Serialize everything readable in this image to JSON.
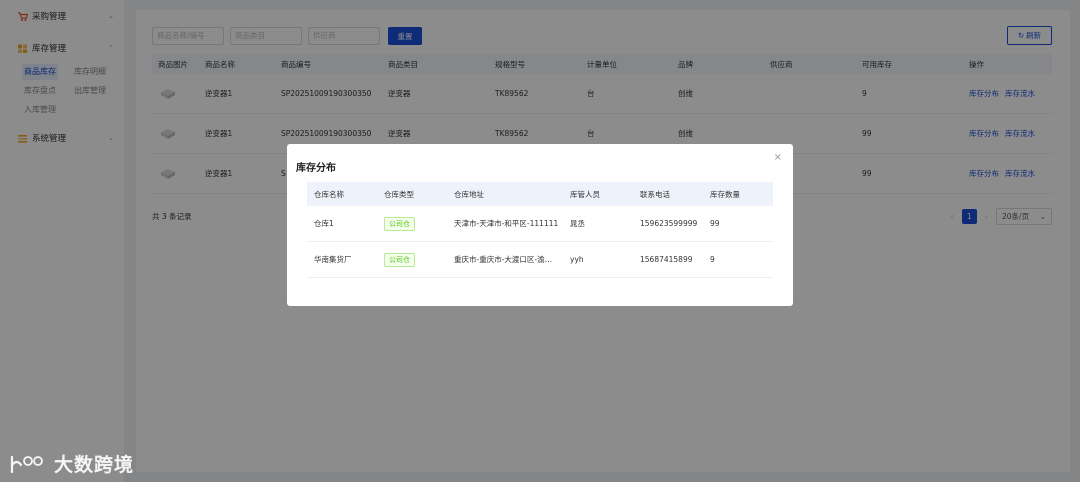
{
  "sidebar": {
    "groups": [
      {
        "label": "采购管理",
        "icon": "cart-icon"
      },
      {
        "label": "库存管理",
        "icon": "inventory-icon"
      },
      {
        "label": "系统管理",
        "icon": "settings-icon"
      }
    ],
    "inventory_items": [
      "商品库存",
      "库存明细",
      "库存盘点",
      "出库管理",
      "入库管理"
    ]
  },
  "filters": {
    "product_placeholder": "商品名称/编号",
    "category_placeholder": "商品类目",
    "supplier_placeholder": "供应商",
    "reset_label": "重置",
    "refresh_label": "刷新"
  },
  "table": {
    "headers": [
      "商品图片",
      "商品名称",
      "商品编号",
      "商品类目",
      "规格型号",
      "计量单位",
      "品牌",
      "供应商",
      "可用库存",
      "操作"
    ],
    "rows": [
      {
        "name": "逆变器1",
        "code": "SP20251009190300350",
        "category": "逆变器",
        "spec": "TK89562",
        "unit": "台",
        "brand": "创维",
        "supplier": "",
        "stock": "9"
      },
      {
        "name": "逆变器1",
        "code": "SP20251009190300350",
        "category": "逆变器",
        "spec": "TK89562",
        "unit": "台",
        "brand": "创维",
        "supplier": "",
        "stock": "99"
      },
      {
        "name": "逆变器1",
        "code": "S",
        "category": "",
        "spec": "",
        "unit": "",
        "brand": "",
        "supplier": "",
        "stock": "99"
      }
    ],
    "ops": [
      "库存分布",
      "库存流水"
    ]
  },
  "footer": {
    "total": "共 3 条记录",
    "page": "1",
    "page_size": "20条/页"
  },
  "modal": {
    "title": "库存分布",
    "close": "×",
    "headers": [
      "仓库名称",
      "仓库类型",
      "仓库地址",
      "库管人员",
      "联系电话",
      "库存数量"
    ],
    "rows": [
      {
        "name": "仓库1",
        "type": "公司仓",
        "address": "天津市-天津市-和平区-111111",
        "keeper": "晁丞",
        "phone": "159623599999",
        "qty": "99"
      },
      {
        "name": "华南集货厂",
        "type": "公司仓",
        "address": "重庆市-重庆市-大渡口区-渝…",
        "keeper": "yyh",
        "phone": "15687415899",
        "qty": "9"
      }
    ]
  },
  "watermark": {
    "text": "大数跨境"
  },
  "colors": {
    "primary": "#1d4ed8",
    "tag_green": "#52c41a"
  }
}
